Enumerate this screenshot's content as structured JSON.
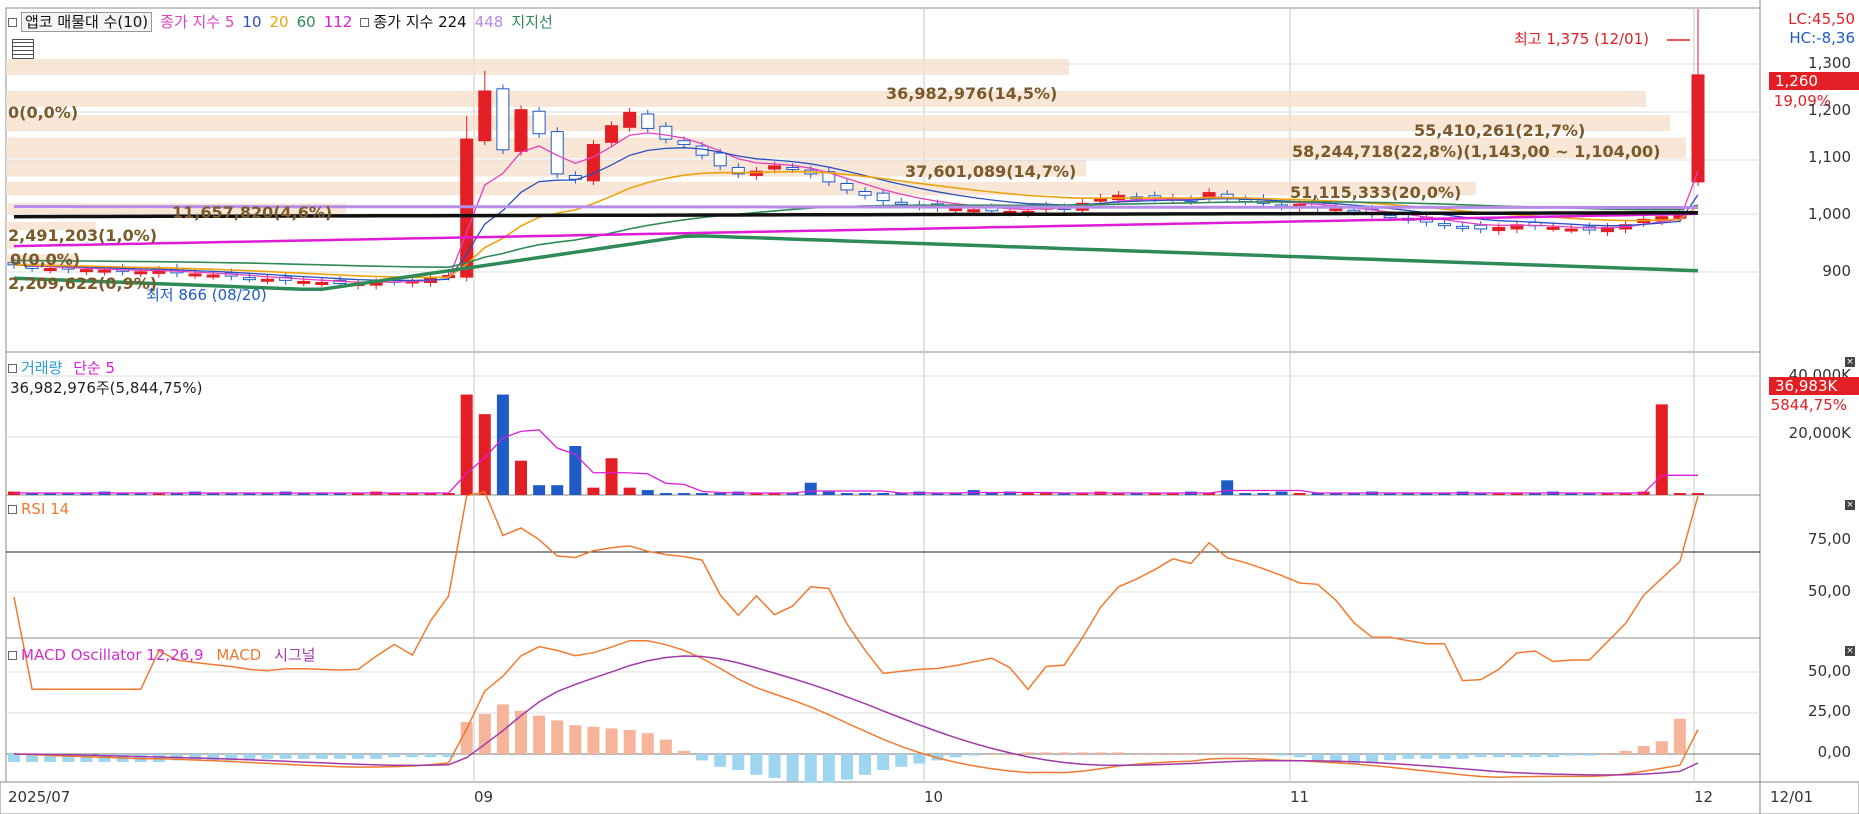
{
  "colors": {
    "up": "#e31e24",
    "down": "#1e5bc6",
    "ma5": "#e63fbf",
    "ma10": "#2a4fc1",
    "ma20": "#f0a20e",
    "ma60": "#2e8b57",
    "ma112": "#e01bd8",
    "ma224": "#111111",
    "ma448": "#b78ce8",
    "volume": "#2a9ed6",
    "rsi": "#f07a30",
    "macd_osc": "#d02fd0"
  },
  "price_panel": {
    "title_items": [
      {
        "text": "앱코 매물대 수(10)",
        "color": "#111111",
        "boxed": true
      },
      {
        "text": "종가 지수 5",
        "color": "#e63fbf"
      },
      {
        "text": "10",
        "color": "#2a4fc1"
      },
      {
        "text": "20",
        "color": "#f0a20e"
      },
      {
        "text": "60",
        "color": "#2e8b57"
      },
      {
        "text": "112",
        "color": "#e01bd8"
      },
      {
        "text": "종가 지수 224",
        "color": "#111111"
      },
      {
        "text": "448",
        "color": "#b78ce8"
      },
      {
        "text": "지지선",
        "color": "#2e8b57"
      }
    ],
    "lc_label": "LC:45,50",
    "hc_label": "HC:-8,36",
    "price_badge": "1,260",
    "change_badge": "19,09%",
    "high_label": "최고 1,375 (12/01)",
    "low_label": "최저 866 (08/20)",
    "y_ticks": [
      "1,300",
      "1,200",
      "1,100",
      "1,000",
      "900"
    ],
    "volume_profile": [
      {
        "text": "36,982,976(14,5%)"
      },
      {
        "text": "0(0,0%)"
      },
      {
        "text": "55,410,261(21,7%)"
      },
      {
        "text": "58,244,718(22,8%)(1,143,00 ~ 1,104,00)"
      },
      {
        "text": "37,601,089(14,7%)"
      },
      {
        "text": "51,115,333(20,0%)"
      },
      {
        "text": "11,657,820(4,6%)"
      },
      {
        "text": "2,491,203(1,0%)"
      },
      {
        "text": "0(0,0%)"
      },
      {
        "text": "2,209,622(0,9%)"
      }
    ]
  },
  "volume_panel": {
    "title": "거래량",
    "ma_label": "단순 5",
    "value_text": "36,982,976주(5,844,75%)",
    "y_ticks": [
      "40,000K",
      "20,000K"
    ],
    "badge": "36,983K",
    "pct": "5844,75%"
  },
  "rsi_panel": {
    "title": "RSI 14",
    "y_ticks": [
      "75,00",
      "50,00"
    ]
  },
  "macd_panel": {
    "title": "MACD Oscillator 12,26,9",
    "macd": "MACD",
    "signal": "시그널",
    "y_ticks": [
      "50,00",
      "25,00",
      "0,00"
    ]
  },
  "x_axis": {
    "labels": [
      "2025/07",
      "09",
      "10",
      "11",
      "12",
      "12/01"
    ]
  },
  "chart_data": {
    "type": "candlestick",
    "title": "앱코",
    "x_period": "2025/07 - 12/01",
    "ylim": [
      800,
      1400
    ],
    "close": [
      905,
      900,
      898,
      897,
      896,
      895,
      893,
      892,
      895,
      890,
      888,
      886,
      884,
      880,
      878,
      876,
      874,
      872,
      870,
      870,
      872,
      874,
      875,
      880,
      885,
      1140,
      1230,
      1120,
      1195,
      1150,
      1075,
      1065,
      1130,
      1165,
      1190,
      1160,
      1140,
      1130,
      1110,
      1090,
      1075,
      1080,
      1090,
      1085,
      1075,
      1060,
      1045,
      1035,
      1025,
      1020,
      1015,
      1012,
      1010,
      1008,
      1006,
      1005,
      1005,
      1015,
      1010,
      1020,
      1030,
      1035,
      1030,
      1030,
      1030,
      1025,
      1040,
      1030,
      1025,
      1020,
      1015,
      1018,
      1012,
      1010,
      1005,
      1000,
      995,
      990,
      985,
      980,
      975,
      972,
      975,
      980,
      978,
      975,
      972,
      970,
      975,
      980,
      990,
      995,
      1000,
      1260
    ],
    "macd_oscillator": [
      -5,
      -5,
      -5,
      -5,
      -5,
      -5,
      -5,
      -5,
      -5,
      -4,
      -4,
      -4,
      -4,
      -4,
      -3,
      -3,
      -3,
      -3,
      -3,
      -3,
      -3,
      -2,
      -2,
      -2,
      -2,
      20,
      25,
      31,
      27,
      24,
      21,
      18,
      17,
      16,
      15,
      13,
      9,
      2,
      -4,
      -8,
      -10,
      -13,
      -15,
      -17,
      -18,
      -18,
      -16,
      -13,
      -10,
      -8,
      -6,
      -4,
      -2,
      -1,
      0,
      0,
      1,
      1,
      1,
      1,
      1,
      1,
      0,
      0,
      0,
      0,
      0,
      0,
      0,
      0,
      -1,
      -2,
      -4,
      -6,
      -6,
      -5,
      -4,
      -3,
      -3,
      -3,
      -3,
      -2,
      -2,
      -2,
      -2,
      -2,
      -1,
      -1,
      0,
      2,
      5,
      8,
      22
    ]
  }
}
